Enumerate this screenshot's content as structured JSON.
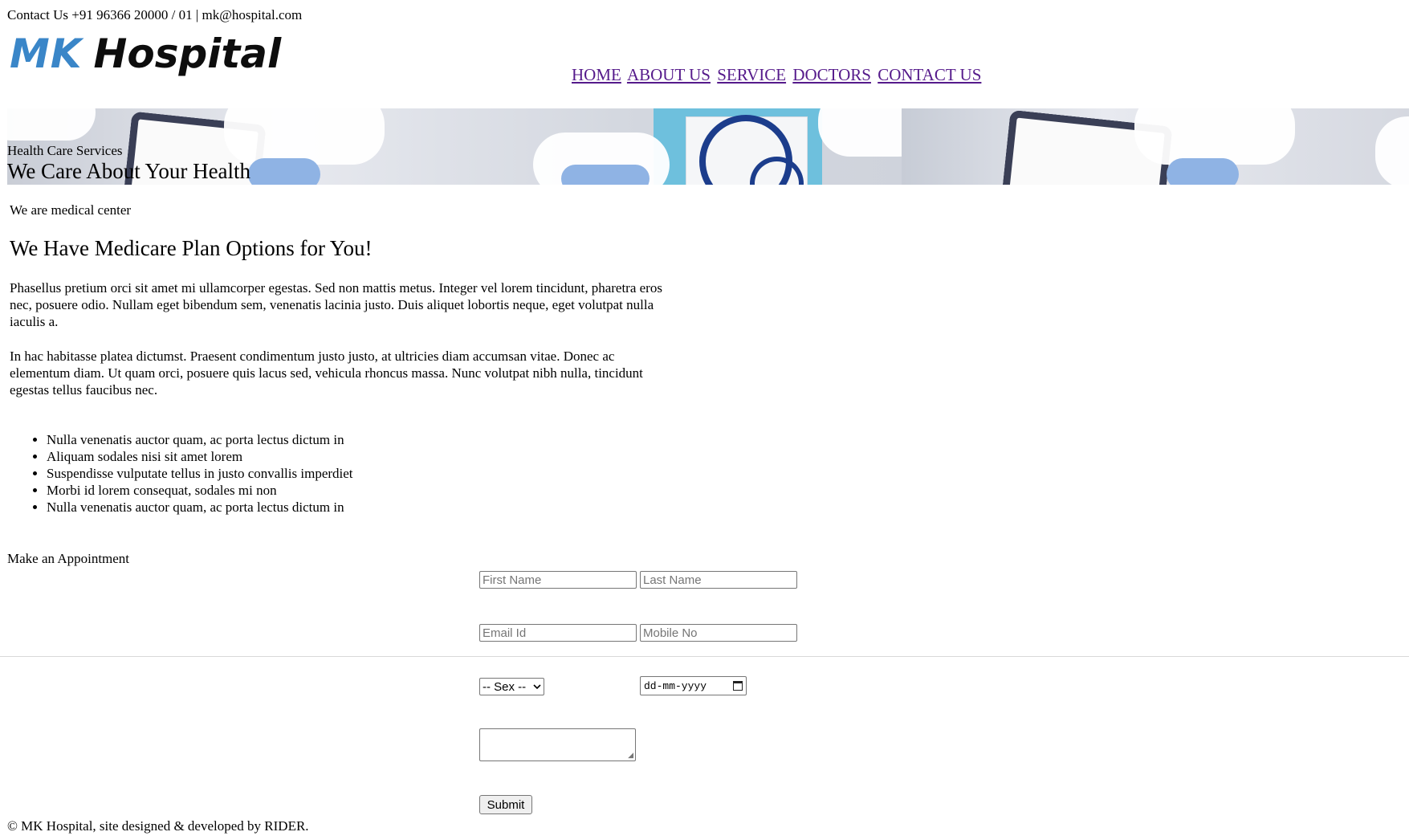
{
  "header": {
    "contact_line": "Contact Us +91 96366 20000 / 01 | mk@hospital.com",
    "logo_mk": "MK",
    "logo_hospital": "Hospital",
    "logo_color": "#3a86c8"
  },
  "nav": {
    "items": [
      "HOME",
      "ABOUT US",
      "SERVICE",
      "DOCTORS",
      "CONTACT US"
    ],
    "link_color": "#551a8b"
  },
  "banner": {
    "subtitle": "Health Care Services",
    "title": "We Care About Your Health"
  },
  "main": {
    "intro": "We are medical center",
    "heading": "We Have Medicare Plan Options for You!",
    "paragraphs": [
      "Phasellus pretium orci sit amet mi ullamcorper egestas. Sed non mattis metus. Integer vel lorem tincidunt, pharetra eros nec, posuere odio. Nullam eget bibendum sem, venenatis lacinia justo. Duis aliquet lobortis neque, eget volutpat nulla iaculis a.",
      "In hac habitasse platea dictumst. Praesent condimentum justo justo, at ultricies diam accumsan vitae. Donec ac elementum diam. Ut quam orci, posuere quis lacus sed, vehicula rhoncus massa. Nunc volutpat nibh nulla, tincidunt egestas tellus faucibus nec."
    ],
    "list": [
      "Nulla venenatis auctor quam, ac porta lectus dictum in",
      "Aliquam sodales nisi sit amet lorem",
      "Suspendisse vulputate tellus in justo convallis imperdiet",
      "Morbi id lorem consequat, sodales mi non",
      "Nulla venenatis auctor quam, ac porta lectus dictum in"
    ]
  },
  "appointment": {
    "title": "Make an Appointment",
    "first_name_placeholder": "First Name",
    "last_name_placeholder": "Last Name",
    "email_placeholder": "Email Id",
    "mobile_placeholder": "Mobile No",
    "sex_selected": "-- Sex --",
    "date_placeholder": "dd-mm-yyyy",
    "submit_label": "Submit"
  },
  "footer": {
    "text": "© MK Hospital, site designed & developed by RIDER."
  }
}
